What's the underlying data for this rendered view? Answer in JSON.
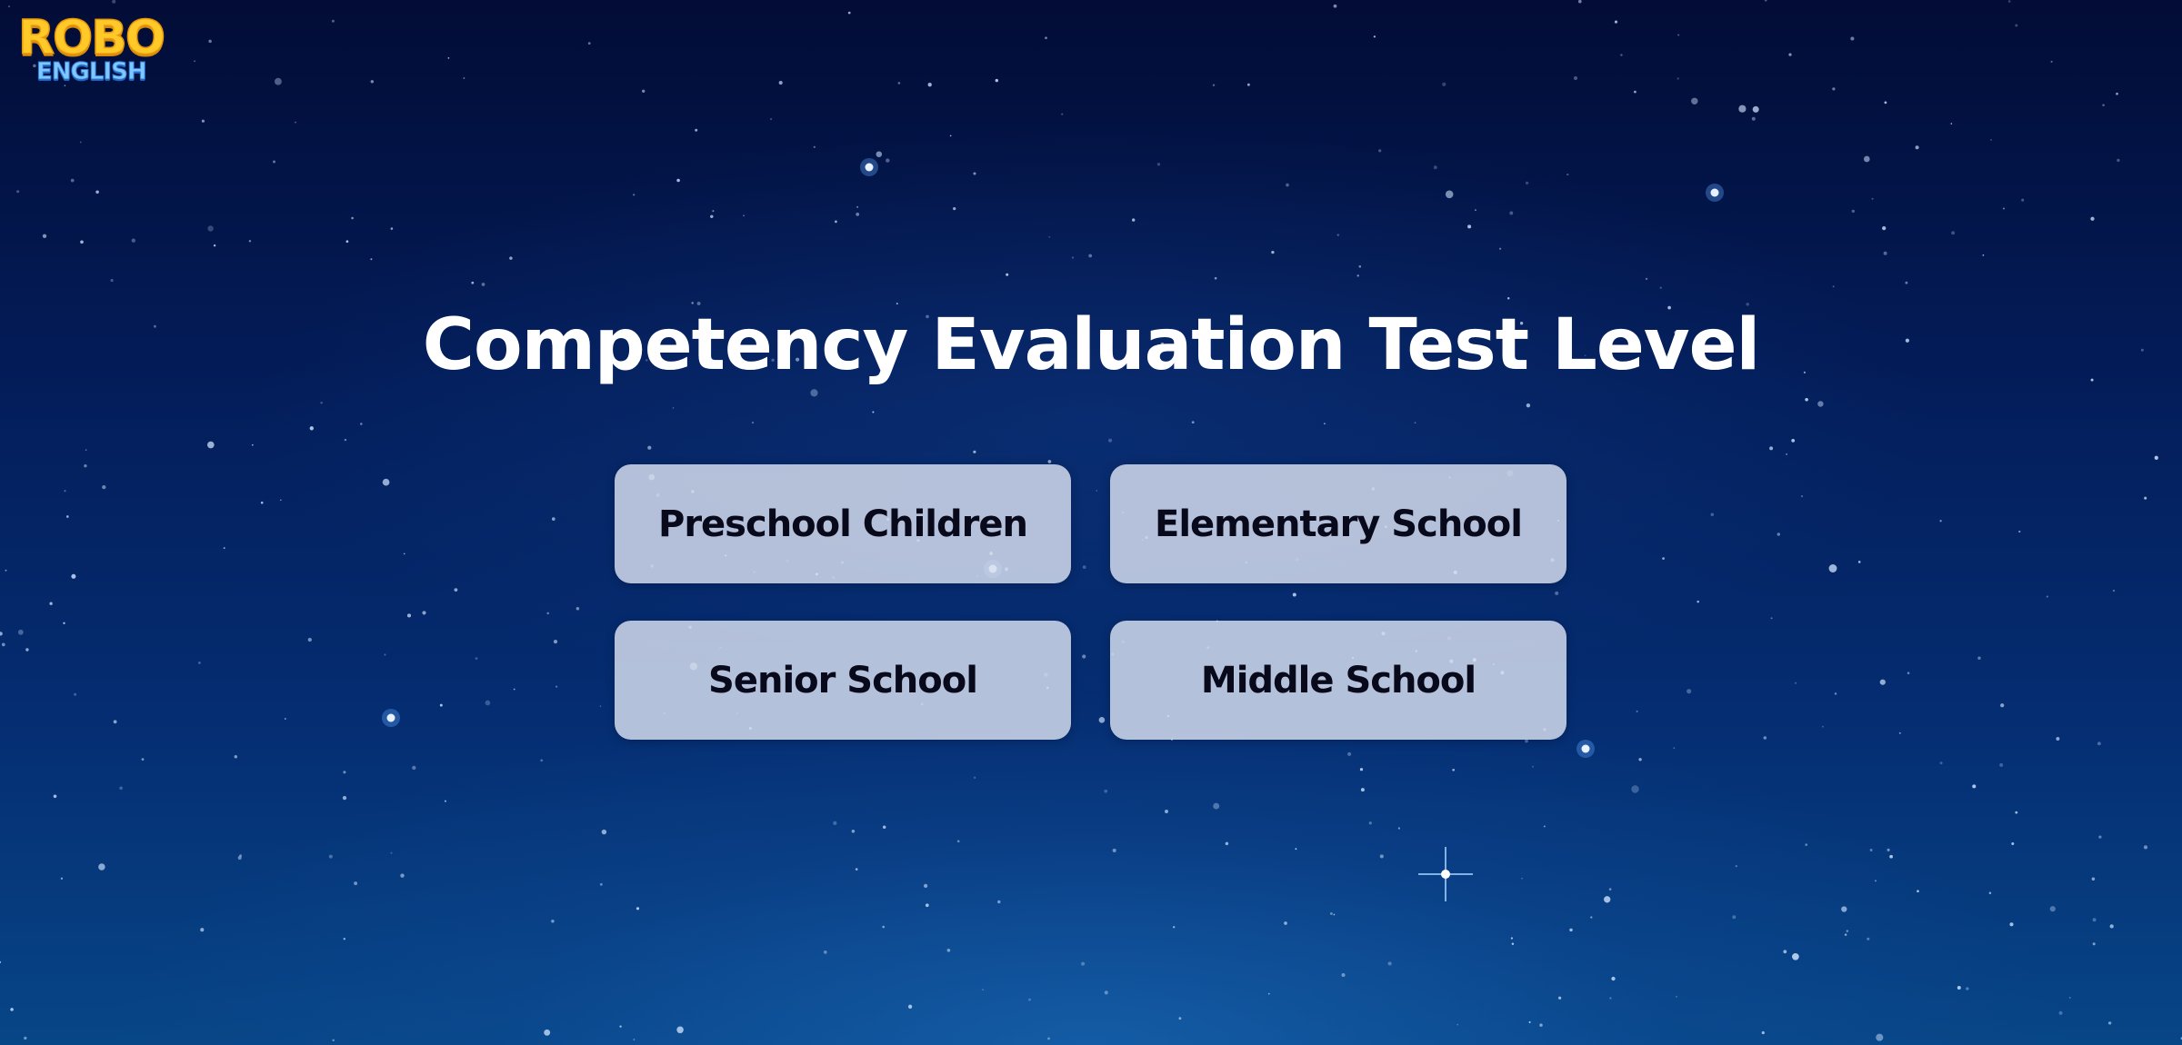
{
  "logo": {
    "line1": "ROBO",
    "line2": "ENGLISH"
  },
  "page": {
    "title": "Competency Evaluation Test Level"
  },
  "levels": [
    {
      "label": "Preschool Children"
    },
    {
      "label": "Elementary School"
    },
    {
      "label": "Senior School"
    },
    {
      "label": "Middle School"
    }
  ],
  "colors": {
    "background_dark": "#020c36",
    "background_light": "#074687",
    "logo_yellow": "#ffc928",
    "logo_blue": "#7fc8ff",
    "button_fill": "#d7deee",
    "button_text": "#08091a",
    "title_text": "#ffffff"
  }
}
